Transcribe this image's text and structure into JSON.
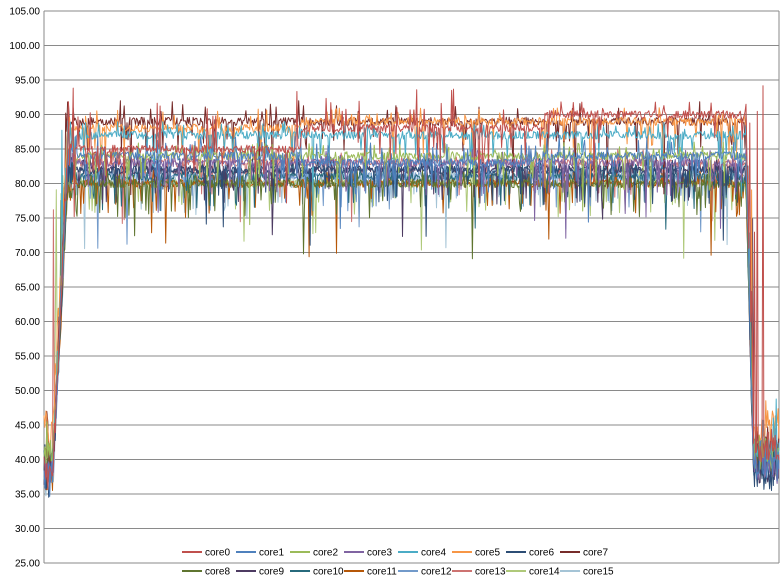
{
  "chart_data": {
    "type": "line",
    "title": "",
    "xlabel": "",
    "ylabel": "",
    "ylim": [
      25,
      105
    ],
    "y_ticks": [
      "25.00",
      "30.00",
      "35.00",
      "40.00",
      "45.00",
      "50.00",
      "55.00",
      "60.00",
      "65.00",
      "70.00",
      "75.00",
      "80.00",
      "85.00",
      "90.00",
      "95.00",
      "100.00",
      "105.00"
    ],
    "grid": true,
    "legend_position": "bottom",
    "series": [
      {
        "name": "core0",
        "color": "#c0504d",
        "levels": [
          38,
          85,
          88,
          90,
          42
        ],
        "peaks": [
          94,
          93,
          94,
          92,
          95
        ]
      },
      {
        "name": "core1",
        "color": "#4f81bd",
        "levels": [
          37,
          84,
          83,
          84,
          39
        ],
        "peaks": [
          87,
          86,
          86,
          87,
          44
        ]
      },
      {
        "name": "core2",
        "color": "#9bbb59",
        "levels": [
          40,
          84,
          84,
          84,
          41
        ],
        "peaks": [
          86,
          86,
          86,
          86,
          45
        ]
      },
      {
        "name": "core3",
        "color": "#8064a2",
        "levels": [
          38,
          83,
          83,
          83,
          39
        ],
        "peaks": [
          85,
          85,
          85,
          85,
          44
        ]
      },
      {
        "name": "core4",
        "color": "#4bacc6",
        "levels": [
          39,
          87,
          87,
          87,
          42
        ],
        "peaks": [
          89,
          89,
          89,
          89,
          49
        ]
      },
      {
        "name": "core5",
        "color": "#f79646",
        "levels": [
          44,
          88,
          89,
          89,
          45
        ],
        "peaks": [
          91,
          91,
          91,
          91,
          61
        ]
      },
      {
        "name": "core6",
        "color": "#2c4d75",
        "levels": [
          37,
          82,
          82,
          82,
          38
        ],
        "peaks": [
          84,
          84,
          84,
          84,
          42
        ]
      },
      {
        "name": "core7",
        "color": "#772c2a",
        "levels": [
          38,
          89,
          89,
          89,
          41
        ],
        "peaks": [
          92,
          92,
          92,
          92,
          46
        ]
      },
      {
        "name": "core8",
        "color": "#5f7530",
        "levels": [
          39,
          80,
          80,
          80,
          40
        ],
        "peaks": [
          82,
          82,
          82,
          82,
          44
        ]
      },
      {
        "name": "core9",
        "color": "#4d3b62",
        "levels": [
          38,
          82,
          82,
          82,
          39
        ],
        "peaks": [
          84,
          84,
          84,
          84,
          43
        ]
      },
      {
        "name": "core10",
        "color": "#276a7c",
        "levels": [
          39,
          81,
          81,
          81,
          40
        ],
        "peaks": [
          83,
          83,
          83,
          83,
          44
        ]
      },
      {
        "name": "core11",
        "color": "#b65708",
        "levels": [
          38,
          80,
          80,
          80,
          40
        ],
        "peaks": [
          82,
          82,
          82,
          82,
          44
        ]
      },
      {
        "name": "core12",
        "color": "#729aca",
        "levels": [
          39,
          81,
          81,
          81,
          40
        ],
        "peaks": [
          83,
          83,
          83,
          83,
          44
        ]
      },
      {
        "name": "core13",
        "color": "#cd7371",
        "levels": [
          40,
          83,
          83,
          83,
          41
        ],
        "peaks": [
          85,
          85,
          85,
          85,
          45
        ]
      },
      {
        "name": "core14",
        "color": "#afc97a",
        "levels": [
          39,
          80,
          80,
          80,
          40
        ],
        "peaks": [
          82,
          82,
          82,
          82,
          44
        ]
      },
      {
        "name": "core15",
        "color": "#a5c4d6",
        "levels": [
          36,
          80,
          81,
          81,
          40
        ],
        "peaks": [
          82,
          82,
          82,
          82,
          44
        ]
      }
    ]
  }
}
